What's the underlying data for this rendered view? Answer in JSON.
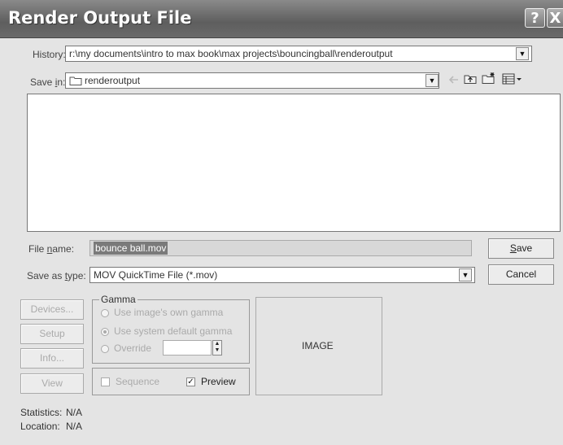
{
  "window": {
    "title": "Render Output File",
    "help_glyph": "?",
    "close_glyph": "X"
  },
  "history": {
    "label": "History:",
    "value": "r:\\my documents\\intro to max book\\max projects\\bouncingball\\renderoutput"
  },
  "save_in": {
    "label_prefix": "Save ",
    "label_key": "i",
    "label_suffix": "n:",
    "value": "renderoutput"
  },
  "file_name": {
    "label_prefix": "File ",
    "label_key": "n",
    "label_suffix": "ame:",
    "value": "bounce ball.mov"
  },
  "save_as_type": {
    "label_prefix": "Save as ",
    "label_key": "t",
    "label_suffix": "ype:",
    "value": "MOV QuickTime File (*.mov)"
  },
  "buttons": {
    "save": {
      "key": "S",
      "rest": "ave"
    },
    "cancel": "Cancel",
    "devices": "Devices...",
    "setup": "Setup",
    "info": "Info...",
    "view": "View"
  },
  "gamma": {
    "title": "Gamma",
    "options": [
      "Use image's own gamma",
      "Use system default gamma",
      "Override"
    ],
    "selected": "Use system default gamma"
  },
  "sequence": {
    "label": "Sequence",
    "checked": false
  },
  "preview": {
    "label": "Preview",
    "checked": true
  },
  "image_placeholder": "IMAGE",
  "statistics": {
    "label": "Statistics:",
    "value": "N/A"
  },
  "location": {
    "label": "Location:",
    "value": "N/A"
  },
  "icons": [
    "folder-icon",
    "back-arrow-icon",
    "up-folder-icon",
    "new-folder-icon",
    "view-menu-icon",
    "dropdown-arrow-icon",
    "help-icon",
    "close-icon"
  ]
}
